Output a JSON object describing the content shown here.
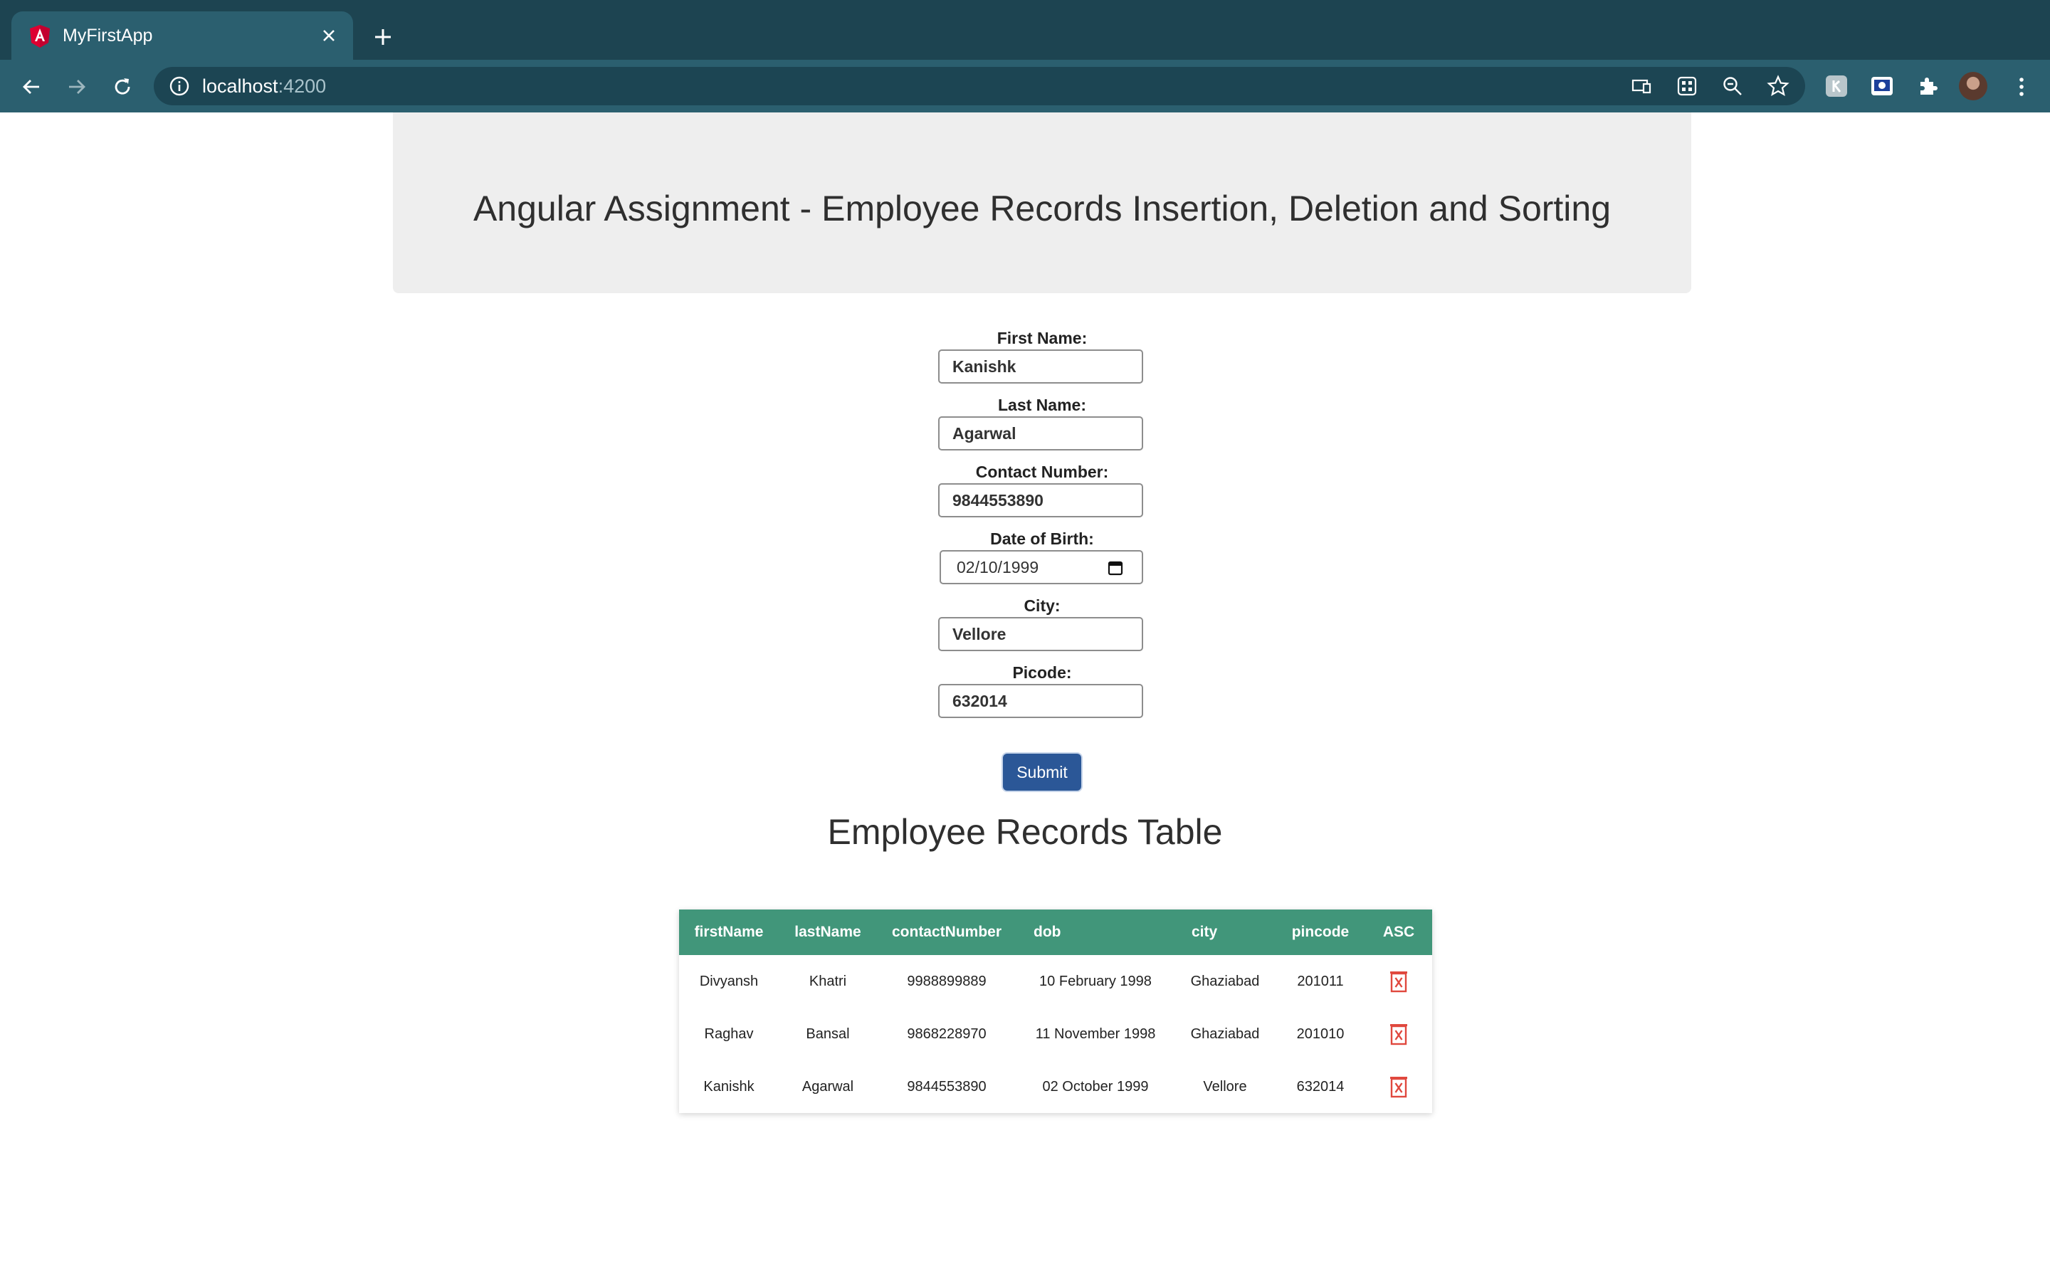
{
  "browser": {
    "tab_title": "MyFirstApp",
    "url_host": "localhost",
    "url_port": ":4200"
  },
  "page": {
    "heading": "Angular Assignment - Employee Records Insertion, Deletion and Sorting",
    "table_title": "Employee Records Table"
  },
  "form": {
    "fields": [
      {
        "label": "First Name:",
        "value": "Kanishk"
      },
      {
        "label": "Last Name:",
        "value": "Agarwal"
      },
      {
        "label": "Contact Number:",
        "value": "9844553890"
      },
      {
        "label": "Date of Birth:",
        "value": "02/10/1999"
      },
      {
        "label": "City:",
        "value": "Vellore"
      },
      {
        "label": "Picode:",
        "value": "632014"
      }
    ],
    "submit_label": "Submit"
  },
  "table": {
    "headers": [
      "firstName",
      "lastName",
      "contactNumber",
      "dob",
      "city",
      "pincode",
      "ASC"
    ],
    "rows": [
      [
        "Divyansh",
        "Khatri",
        "9988899889",
        "10 February 1998",
        "Ghaziabad",
        "201011"
      ],
      [
        "Raghav",
        "Bansal",
        "9868228970",
        "11 November 1998",
        "Ghaziabad",
        "201010"
      ],
      [
        "Kanishk",
        "Agarwal",
        "9844553890",
        "02 October 1999",
        "Vellore",
        "632014"
      ]
    ]
  },
  "colors": {
    "tab_bar": "#1d4451",
    "toolbar": "#2b5f6f",
    "table_header": "#41967a",
    "submit_button": "#2b5797",
    "delete_icon": "#e0483e"
  },
  "icons": [
    "angular-favicon-icon",
    "close-icon",
    "plus-icon",
    "back-arrow-icon",
    "forward-arrow-icon",
    "reload-icon",
    "info-icon",
    "cast-icon",
    "qr-code-icon",
    "zoom-out-icon",
    "star-icon",
    "extension-icon",
    "puzzle-icon",
    "calendar-icon",
    "delete-icon",
    "more-vert-icon"
  ]
}
